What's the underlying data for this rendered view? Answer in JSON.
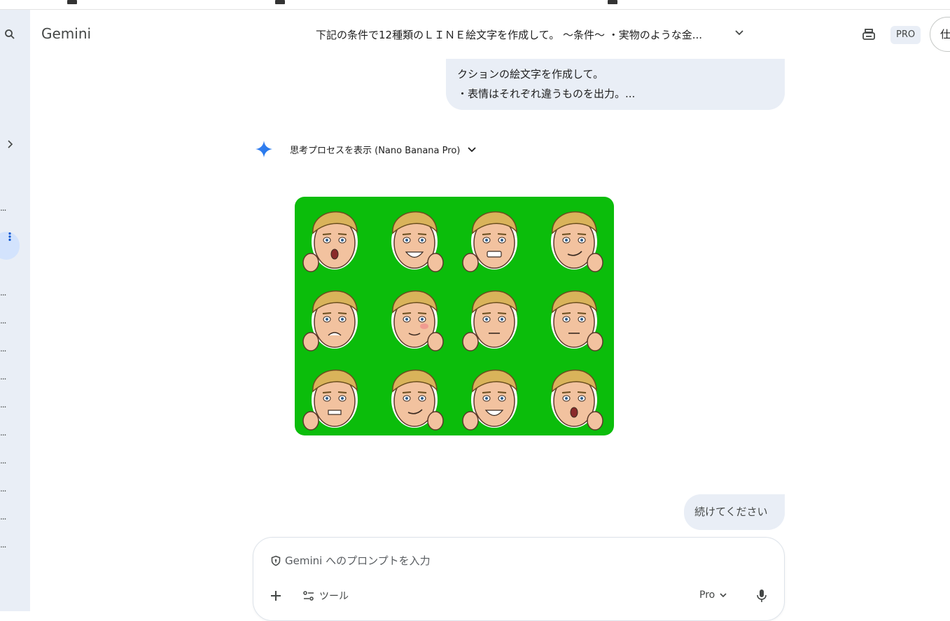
{
  "header": {
    "brand": "Gemini",
    "conversation_title": "下記の条件で12種類のＬＩＮＥ絵文字を作成して。 〜条件〜 ・実物のような金...",
    "plan_badge": "PRO",
    "avatar_initial": "仕"
  },
  "user_messages": [
    {
      "lines": [
        "クションの絵文字を作成して。",
        "・表情はそれぞれ違うものを出力。..."
      ]
    },
    {
      "text": "続けてください"
    }
  ],
  "model_response": {
    "thinking_toggle": "思考プロセスを表示 (Nano Banana Pro)",
    "image_background": "#0bbd0b"
  },
  "composer": {
    "placeholder": "Gemini へのプロンプトを入力",
    "tools_label": "ツール",
    "model_label": "Pro"
  },
  "sidebar": {
    "truncated_item": "..."
  },
  "colors": {
    "accent": "#1a73e8",
    "rail_bg": "#e9eef6",
    "bubble_bg": "#e9eef6",
    "active_item": "#d3e3fd"
  }
}
